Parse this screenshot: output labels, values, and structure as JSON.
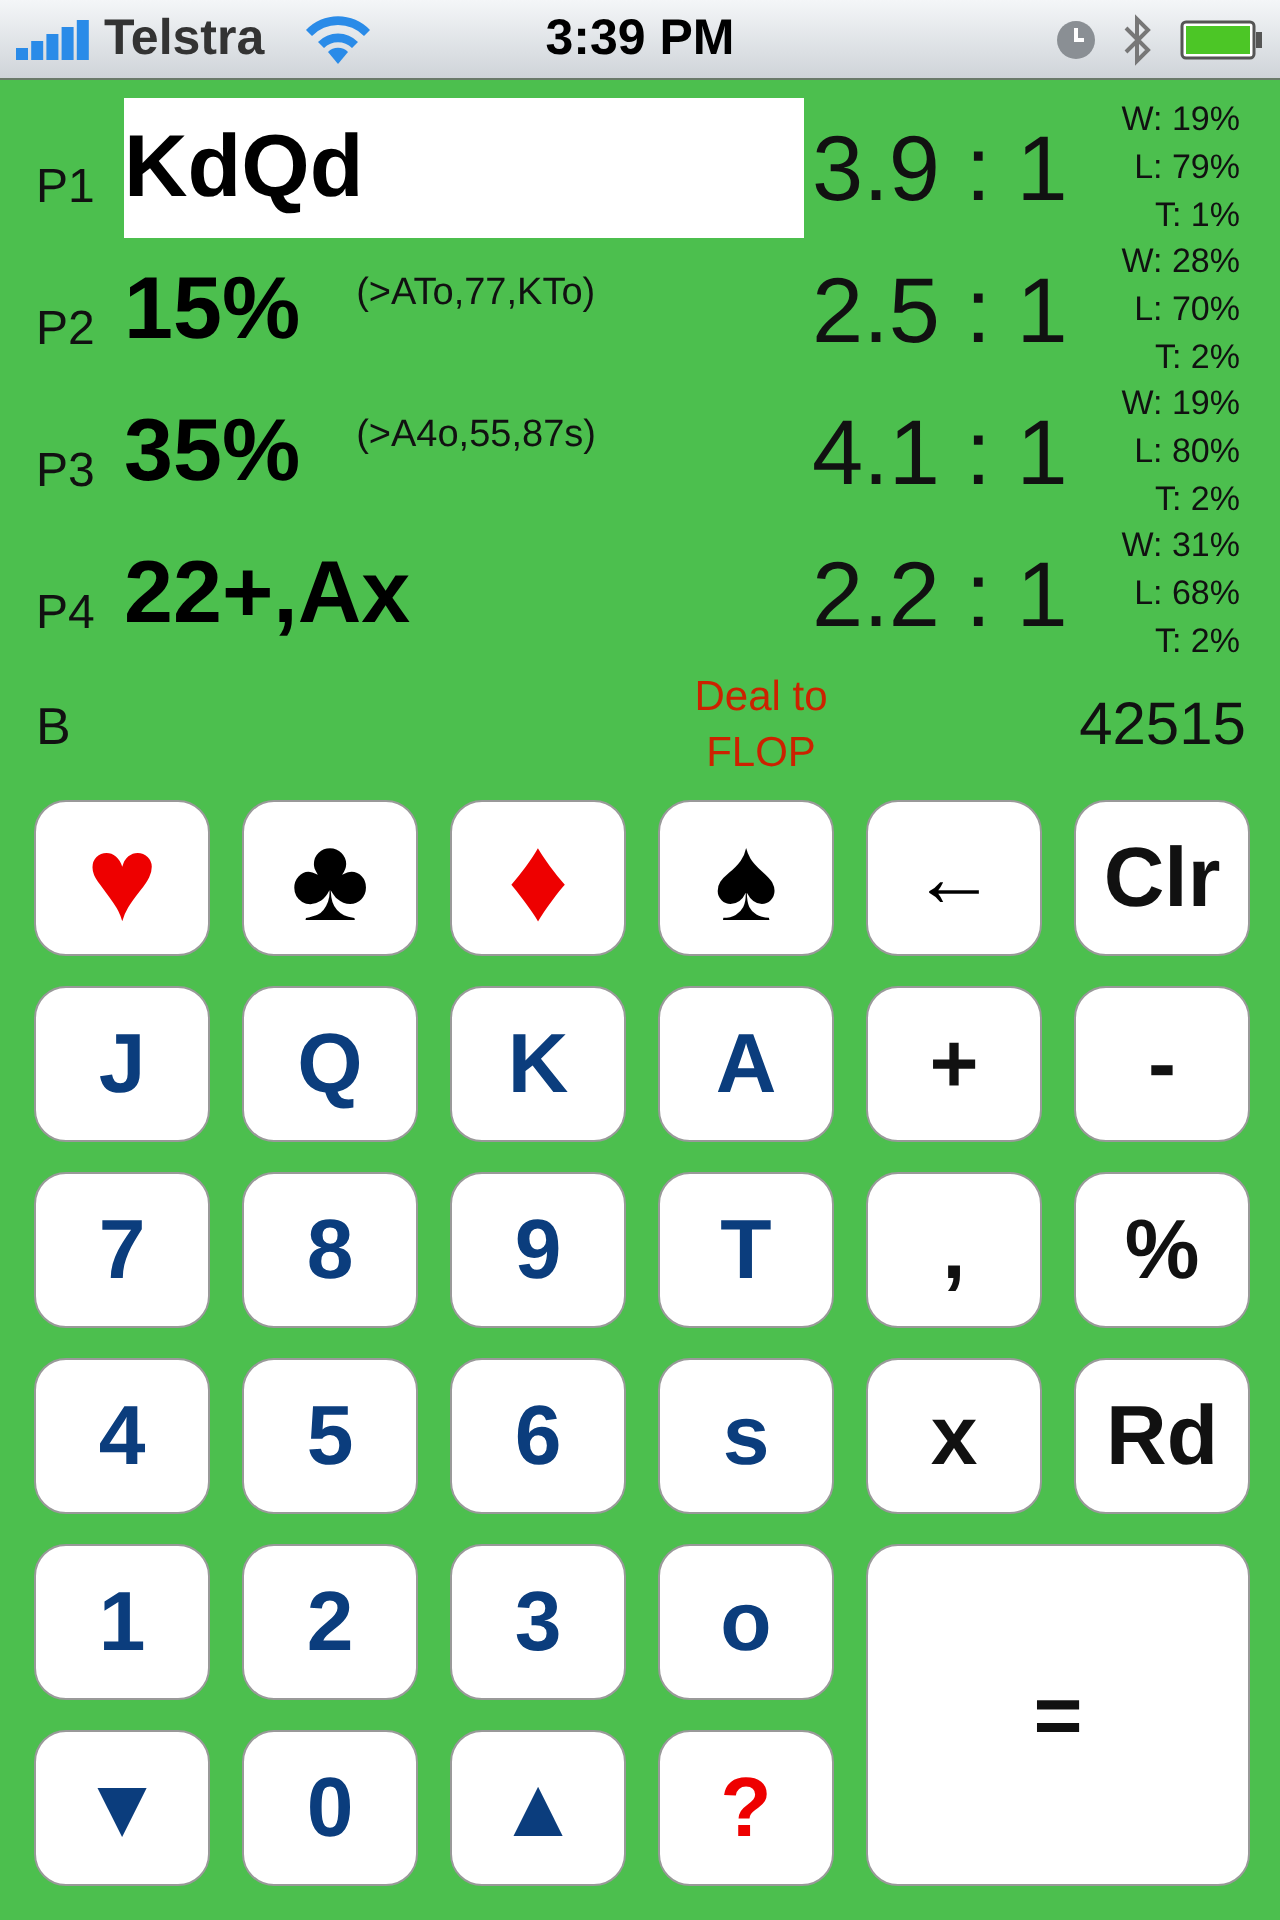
{
  "status_bar": {
    "carrier": "Telstra",
    "time": "3:39 PM"
  },
  "players": [
    {
      "label": "P1",
      "hand": "KdQd",
      "selected": true,
      "odds": "3.9 : 1",
      "win": "W: 19%",
      "loss": "L: 79%",
      "tie": "T: 1%"
    },
    {
      "label": "P2",
      "hand": "15%",
      "range": "(>ATo,77,KTo)",
      "selected": false,
      "odds": "2.5 : 1",
      "win": "W: 28%",
      "loss": "L: 70%",
      "tie": "T: 2%"
    },
    {
      "label": "P3",
      "hand": "35%",
      "range": "(>A4o,55,87s)",
      "selected": false,
      "odds": "4.1 : 1",
      "win": "W: 19%",
      "loss": "L: 80%",
      "tie": "T: 2%"
    },
    {
      "label": "P4",
      "hand": "22+,Ax",
      "selected": false,
      "odds": "2.2 : 1",
      "win": "W: 31%",
      "loss": "L: 68%",
      "tie": "T: 2%"
    }
  ],
  "board": {
    "label": "B",
    "deal_button": "Deal to\nFLOP",
    "count": "42515"
  },
  "keys": [
    {
      "label": "♥",
      "kind": "suit",
      "color": "#ee0000"
    },
    {
      "label": "♣",
      "kind": "suit",
      "color": "#000000"
    },
    {
      "label": "♦",
      "kind": "suit",
      "color": "#ee0000"
    },
    {
      "label": "♠",
      "kind": "suit",
      "color": "#000000"
    },
    {
      "label": "←",
      "kind": "key",
      "color": "#000000"
    },
    {
      "label": "Clr",
      "kind": "key",
      "color": "#111111"
    },
    {
      "label": "J",
      "kind": "key",
      "color": "#0b3d7d"
    },
    {
      "label": "Q",
      "kind": "key",
      "color": "#0b3d7d"
    },
    {
      "label": "K",
      "kind": "key",
      "color": "#0b3d7d"
    },
    {
      "label": "A",
      "kind": "key",
      "color": "#0b3d7d"
    },
    {
      "label": "+",
      "kind": "key",
      "color": "#111111"
    },
    {
      "label": "-",
      "kind": "key",
      "color": "#111111"
    },
    {
      "label": "7",
      "kind": "key",
      "color": "#0b3d7d"
    },
    {
      "label": "8",
      "kind": "key",
      "color": "#0b3d7d"
    },
    {
      "label": "9",
      "kind": "key",
      "color": "#0b3d7d"
    },
    {
      "label": "T",
      "kind": "key",
      "color": "#0b3d7d"
    },
    {
      "label": ",",
      "kind": "key",
      "color": "#111111"
    },
    {
      "label": "%",
      "kind": "key",
      "color": "#111111"
    },
    {
      "label": "4",
      "kind": "key",
      "color": "#0b3d7d"
    },
    {
      "label": "5",
      "kind": "key",
      "color": "#0b3d7d"
    },
    {
      "label": "6",
      "kind": "key",
      "color": "#0b3d7d"
    },
    {
      "label": "s",
      "kind": "key",
      "color": "#0b3d7d"
    },
    {
      "label": "x",
      "kind": "key",
      "color": "#111111"
    },
    {
      "label": "Rd",
      "kind": "key",
      "color": "#111111"
    },
    {
      "label": "1",
      "kind": "key",
      "color": "#0b3d7d"
    },
    {
      "label": "2",
      "kind": "key",
      "color": "#0b3d7d"
    },
    {
      "label": "3",
      "kind": "key",
      "color": "#0b3d7d"
    },
    {
      "label": "o",
      "kind": "key",
      "color": "#0b3d7d"
    },
    {
      "label": "=",
      "kind": "wide",
      "color": "#111111"
    },
    {
      "label": "▼",
      "kind": "key",
      "color": "#0b3d7d"
    },
    {
      "label": "0",
      "kind": "key",
      "color": "#0b3d7d"
    },
    {
      "label": "▲",
      "kind": "key",
      "color": "#0b3d7d"
    },
    {
      "label": "?",
      "kind": "key",
      "color": "#ee0000"
    }
  ]
}
